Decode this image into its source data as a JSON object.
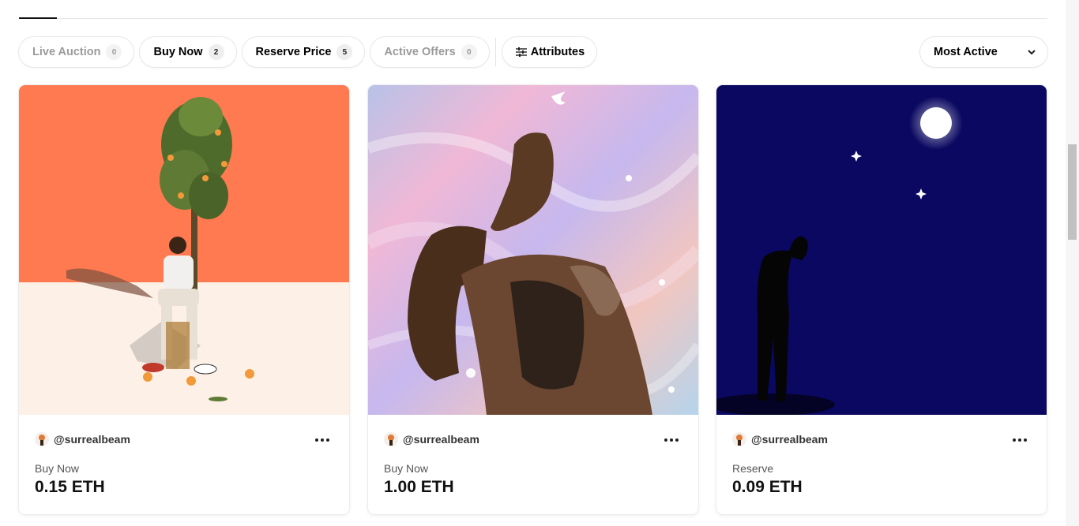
{
  "filters": [
    {
      "label": "Live Auction",
      "count": "0",
      "disabled": true
    },
    {
      "label": "Buy Now",
      "count": "2",
      "disabled": false
    },
    {
      "label": "Reserve Price",
      "count": "5",
      "disabled": false
    },
    {
      "label": "Active Offers",
      "count": "0",
      "disabled": true
    }
  ],
  "attributes": {
    "label": "Attributes",
    "icon": "sliders-icon"
  },
  "sort": {
    "selected": "Most Active",
    "icon": "chevron-down-icon"
  },
  "cards": [
    {
      "creator": "@surrealbeam",
      "status": "Buy Now",
      "price": "0.15 ETH",
      "art": "figure-under-orange-tree"
    },
    {
      "creator": "@surrealbeam",
      "status": "Buy Now",
      "price": "1.00 ETH",
      "art": "figure-on-iridescent-background"
    },
    {
      "creator": "@surrealbeam",
      "status": "Reserve",
      "price": "0.09 ETH",
      "art": "silhouette-under-full-moon"
    }
  ],
  "colors": {
    "accent": "#111111",
    "muted": "#9a9a9a",
    "card_border": "#ececec"
  }
}
